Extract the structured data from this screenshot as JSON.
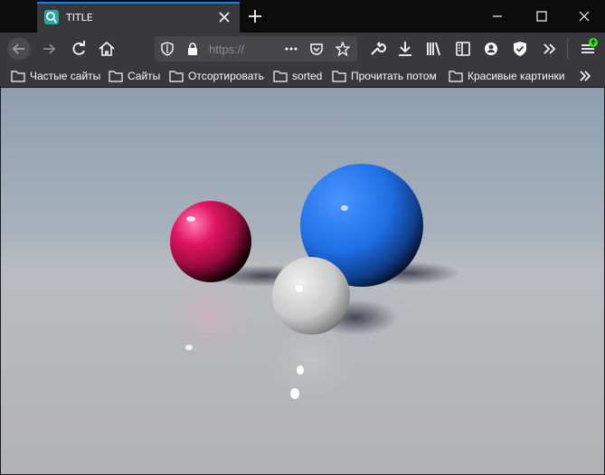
{
  "tab": {
    "title": "TITLE"
  },
  "urlbar": {
    "text": "https://"
  },
  "bookmarks": [
    {
      "label": "Частые сайты"
    },
    {
      "label": "Сайты"
    },
    {
      "label": "Отсортировать"
    },
    {
      "label": "sorted"
    },
    {
      "label": "Прочитать потом"
    },
    {
      "label": "Красивые картинки"
    }
  ],
  "scene": {
    "spheres": [
      {
        "name": "magenta-sphere",
        "color": "#e0155f"
      },
      {
        "name": "blue-sphere",
        "color": "#1e6fe6"
      },
      {
        "name": "white-sphere",
        "color": "#d6d6d6"
      }
    ]
  }
}
